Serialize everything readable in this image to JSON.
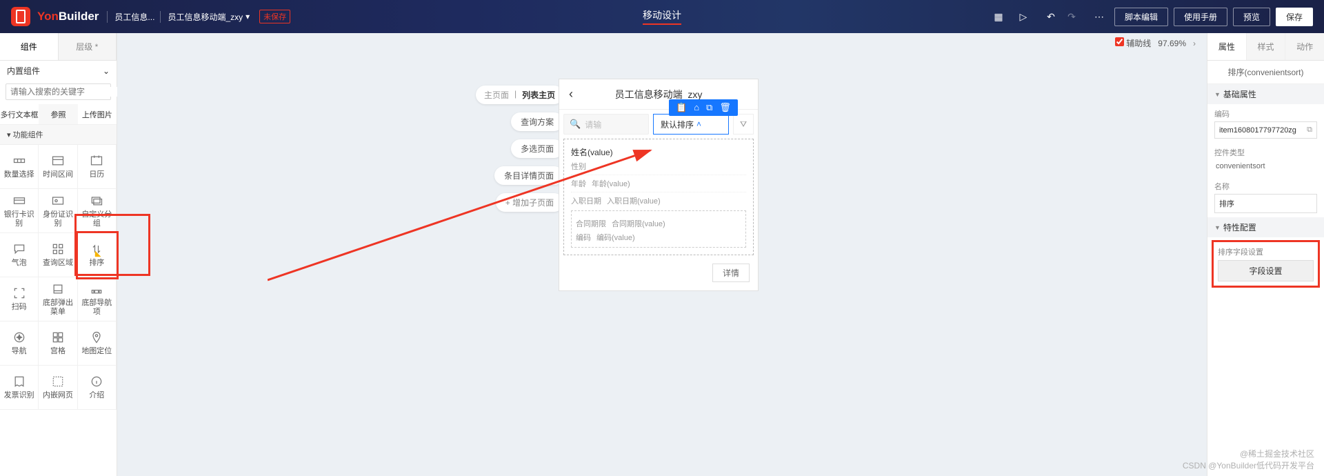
{
  "header": {
    "brand": {
      "accent": "Yon",
      "rest": "Builder"
    },
    "crumb1": "员工信息...",
    "crumb2": "员工信息移动端_zxy",
    "unsaved_tag": "未保存",
    "center_title": "移动设计",
    "script_btn": "脚本编辑",
    "manual_btn": "使用手册",
    "preview_btn": "预览",
    "save_btn": "保存"
  },
  "left": {
    "tabs": [
      "组件",
      "层级 *"
    ],
    "builtin_label": "内置组件",
    "search_placeholder": "请输入搜索的关键字",
    "category_tabs": [
      "多行文本框",
      "参照",
      "上传图片"
    ],
    "group_header": "功能组件",
    "components": [
      {
        "label": "数量选择",
        "icon": "counter"
      },
      {
        "label": "时间区间",
        "icon": "range"
      },
      {
        "label": "日历",
        "icon": "calendar"
      },
      {
        "label": "银行卡识别",
        "icon": "card"
      },
      {
        "label": "身份证识别",
        "icon": "idcard"
      },
      {
        "label": "自定义分组",
        "icon": "stack"
      },
      {
        "label": "气泡",
        "icon": "bubble"
      },
      {
        "label": "查询区域",
        "icon": "grid"
      },
      {
        "label": "排序",
        "icon": "sort"
      },
      {
        "label": "扫码",
        "icon": "scan"
      },
      {
        "label": "底部弹出菜单",
        "icon": "sheet"
      },
      {
        "label": "底部导航项",
        "icon": "navitem"
      },
      {
        "label": "导航",
        "icon": "nav"
      },
      {
        "label": "宫格",
        "icon": "tiles"
      },
      {
        "label": "地图定位",
        "icon": "pin"
      },
      {
        "label": "发票识别",
        "icon": "invoice"
      },
      {
        "label": "内嵌网页",
        "icon": "web"
      },
      {
        "label": "介绍",
        "icon": "info"
      }
    ]
  },
  "center": {
    "aux_line_label": "辅助线",
    "zoom_percent": "97.69%",
    "pages": {
      "main_label": "主页面",
      "main_value": "列表主页",
      "others": [
        "查询方案",
        "多选页面",
        "条目详情页面"
      ],
      "add_child": "增加子页面"
    },
    "device": {
      "title": "员工信息移动端_zxy",
      "search_placeholder": "请输",
      "sort_label": "默认排序",
      "card": {
        "name_label": "姓名(value)",
        "gender_label": "性别",
        "age_label": "年龄",
        "age_value": "年龄(value)",
        "hire_label": "入职日期",
        "hire_value": "入职日期(value)",
        "contract_label": "合同期限",
        "contract_value": "合同期限(value)",
        "code_label": "编码",
        "code_value": "编码(value)"
      },
      "detail_btn": "详情"
    }
  },
  "right": {
    "tabs": [
      "属性",
      "样式",
      "动作"
    ],
    "title": "排序(convenientsort)",
    "section_basic": "基础属性",
    "code_label": "编码",
    "code_value": "item1608017797720zg",
    "type_label": "控件类型",
    "type_value": "convenientsort",
    "name_label": "名称",
    "name_value": "排序",
    "section_trait": "特性配置",
    "sort_field_label": "排序字段设置",
    "field_setting_btn": "字段设置"
  },
  "watermark": {
    "line1": "@稀土掘金技术社区",
    "line2": "CSDN @YonBuilder低代码开发平台"
  }
}
